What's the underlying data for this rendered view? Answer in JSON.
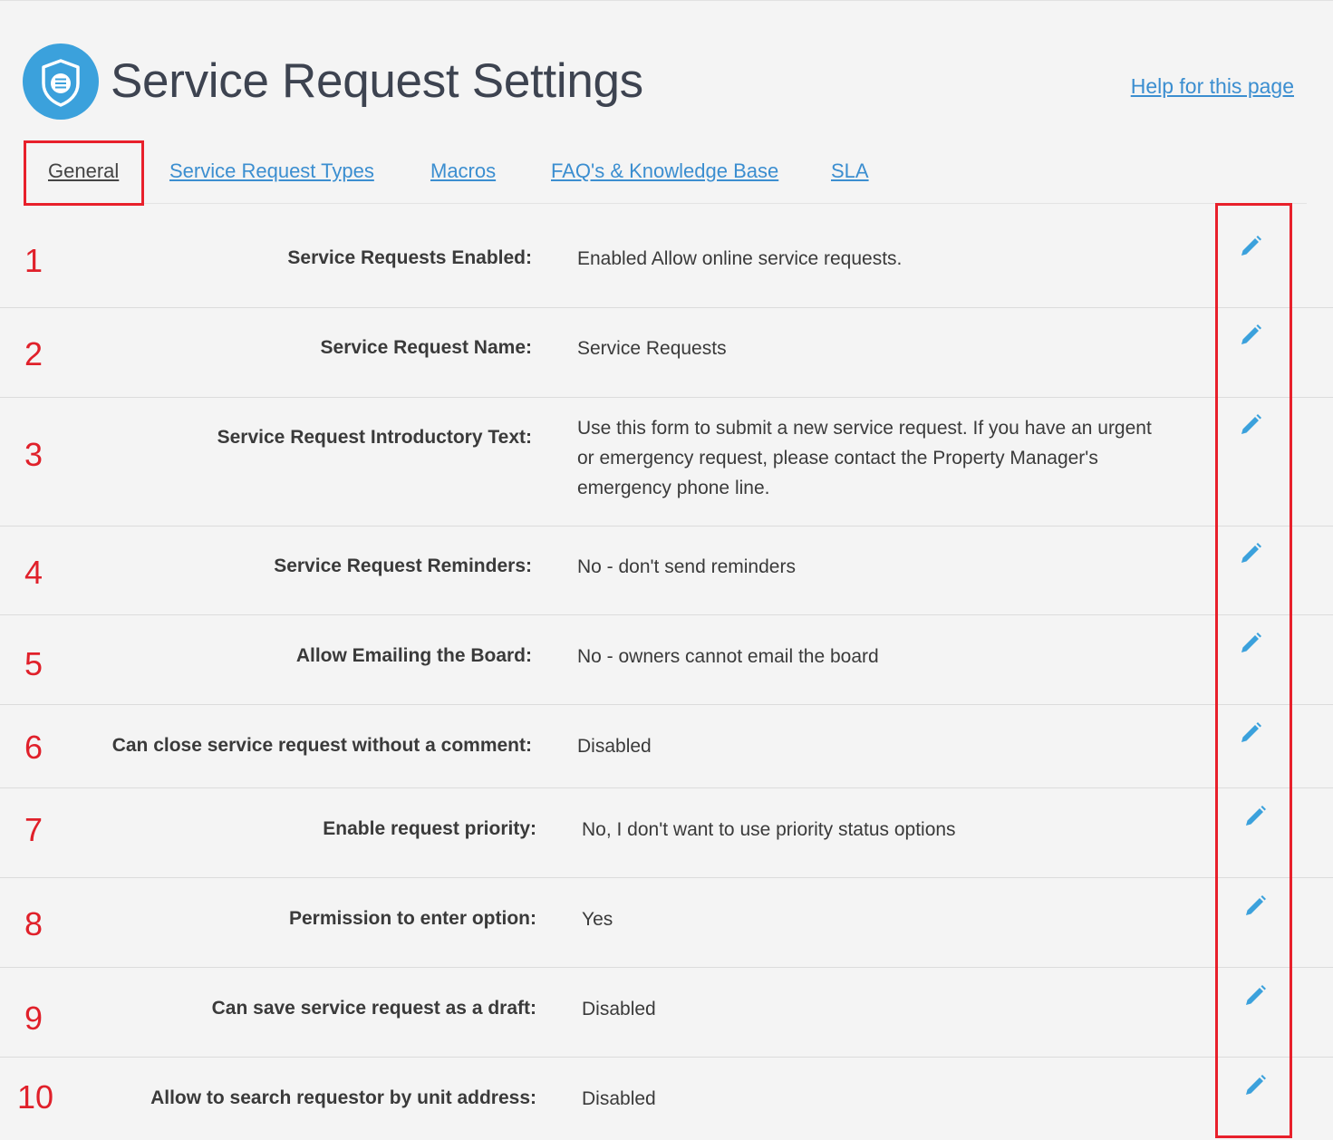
{
  "header": {
    "title": "Service Request Settings",
    "help_link": "Help for this page",
    "logo_icon": "shield-list-icon",
    "accent_color": "#3ba1dc"
  },
  "tabs": [
    {
      "label": "General",
      "active": true
    },
    {
      "label": "Service Request Types",
      "active": false
    },
    {
      "label": "Macros",
      "active": false
    },
    {
      "label": "FAQ's & Knowledge Base",
      "active": false
    },
    {
      "label": "SLA",
      "active": false
    }
  ],
  "settings": [
    {
      "number": "1",
      "label": "Service Requests Enabled:",
      "value": "Enabled Allow online service requests.",
      "action_icon": "pencil-icon"
    },
    {
      "number": "2",
      "label": "Service Request Name:",
      "value": "Service Requests",
      "action_icon": "pencil-icon"
    },
    {
      "number": "3",
      "label": "Service Request Introductory Text:",
      "value": "Use this form to submit a new service request. If you have an urgent or emergency request, please contact the Property Manager's emergency phone line.",
      "action_icon": "pencil-icon"
    },
    {
      "number": "4",
      "label": "Service Request Reminders:",
      "value": "No - don't send reminders",
      "action_icon": "pencil-icon"
    },
    {
      "number": "5",
      "label": "Allow Emailing the Board:",
      "value": "No - owners cannot email the board",
      "action_icon": "pencil-icon"
    },
    {
      "number": "6",
      "label": "Can close service request without a comment:",
      "value": "Disabled",
      "action_icon": "pencil-icon"
    },
    {
      "number": "7",
      "label": "Enable request priority:",
      "value": "No, I don't want to use priority status options",
      "action_icon": "pencil-icon"
    },
    {
      "number": "8",
      "label": "Permission to enter option:",
      "value": "Yes",
      "action_icon": "pencil-icon"
    },
    {
      "number": "9",
      "label": "Can save service request as a draft:",
      "value": "Disabled",
      "action_icon": "pencil-icon"
    },
    {
      "number": "10",
      "label": "Allow to search requestor by unit address:",
      "value": "Disabled",
      "action_icon": "pencil-icon"
    }
  ],
  "colors": {
    "link": "#3b8ed0",
    "annotation": "#e8202b",
    "edit_icon": "#3ba1dc"
  }
}
